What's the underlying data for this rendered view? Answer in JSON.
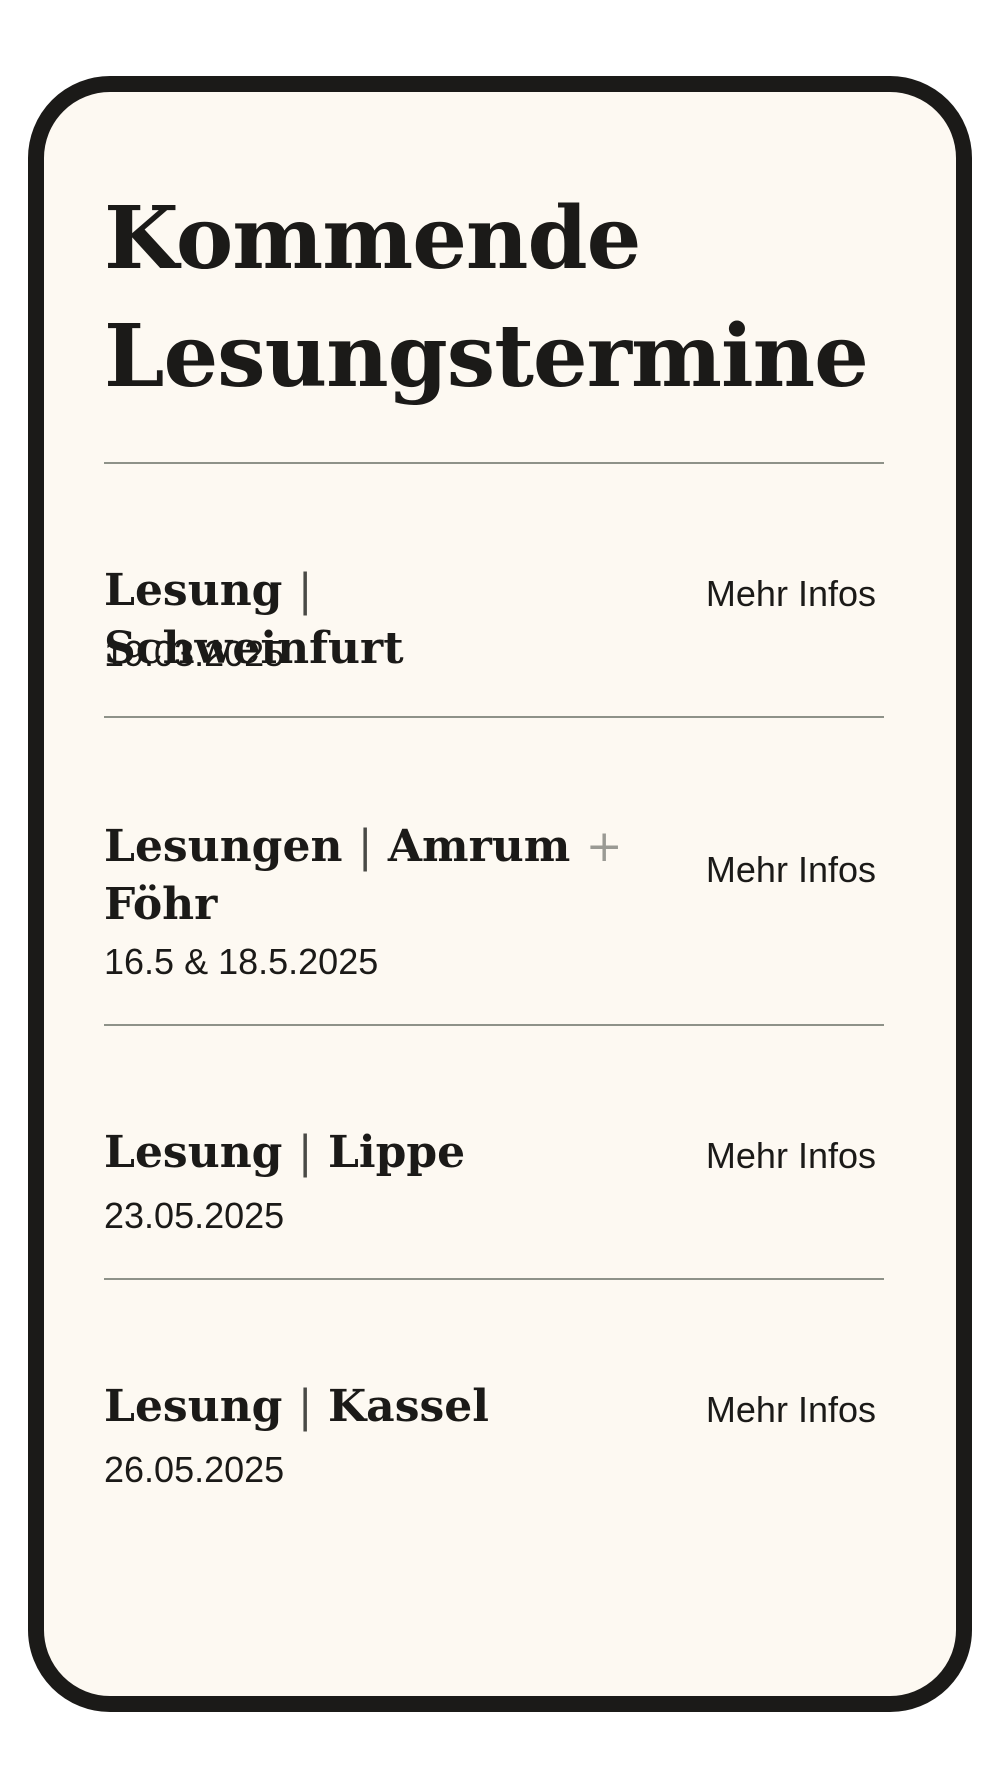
{
  "page": {
    "title": "Kommende Lesungstermine"
  },
  "events": [
    {
      "type": "Lesung",
      "separator": "|",
      "place": "Schweinfurt",
      "extra": "",
      "place2": "",
      "date": "19.03.2025",
      "link": "Mehr Infos"
    },
    {
      "type": "Lesungen",
      "separator": "|",
      "place": "Amrum",
      "extra": "+",
      "place2": "Föhr",
      "date": "16.5 & 18.5.2025",
      "link": "Mehr Infos"
    },
    {
      "type": "Lesung",
      "separator": "|",
      "place": "Lippe",
      "extra": "",
      "place2": "",
      "date": "23.05.2025",
      "link": "Mehr Infos"
    },
    {
      "type": "Lesung",
      "separator": "|",
      "place": "Kassel",
      "extra": "",
      "place2": "",
      "date": "26.05.2025",
      "link": "Mehr Infos"
    }
  ]
}
